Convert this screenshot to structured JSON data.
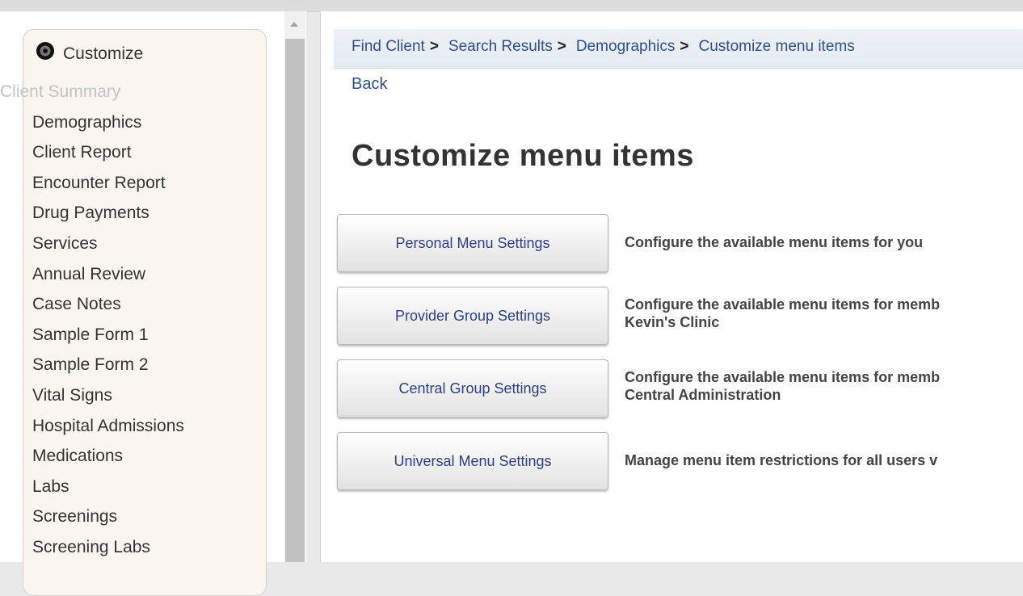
{
  "sidebar": {
    "title": "Customize",
    "items": [
      {
        "label": "Client Summary"
      },
      {
        "label": "Demographics"
      },
      {
        "label": "Client Report"
      },
      {
        "label": "Encounter Report"
      },
      {
        "label": "Drug Payments"
      },
      {
        "label": "Services"
      },
      {
        "label": "Annual Review"
      },
      {
        "label": "Case Notes"
      },
      {
        "label": "Sample Form 1"
      },
      {
        "label": "Sample Form 2"
      },
      {
        "label": "Vital Signs"
      },
      {
        "label": "Hospital Admissions"
      },
      {
        "label": "Medications"
      },
      {
        "label": "Labs"
      },
      {
        "label": "Screenings"
      },
      {
        "label": "Screening Labs"
      }
    ]
  },
  "breadcrumb": {
    "items": [
      "Find Client",
      "Search Results",
      "Demographics",
      "Customize menu items"
    ],
    "separator": ">"
  },
  "back_label": "Back",
  "page_title": "Customize menu items",
  "options": [
    {
      "button": "Personal Menu Settings",
      "line1": "Configure the available menu items for you",
      "line2": ""
    },
    {
      "button": "Provider Group Settings",
      "line1": "Configure the available menu items for memb",
      "line2": "Kevin's Clinic"
    },
    {
      "button": "Central Group Settings",
      "line1": "Configure the available menu items for memb",
      "line2": "Central Administration"
    },
    {
      "button": "Universal Menu Settings",
      "line1": "Manage menu item restrictions for all users v",
      "line2": ""
    }
  ]
}
